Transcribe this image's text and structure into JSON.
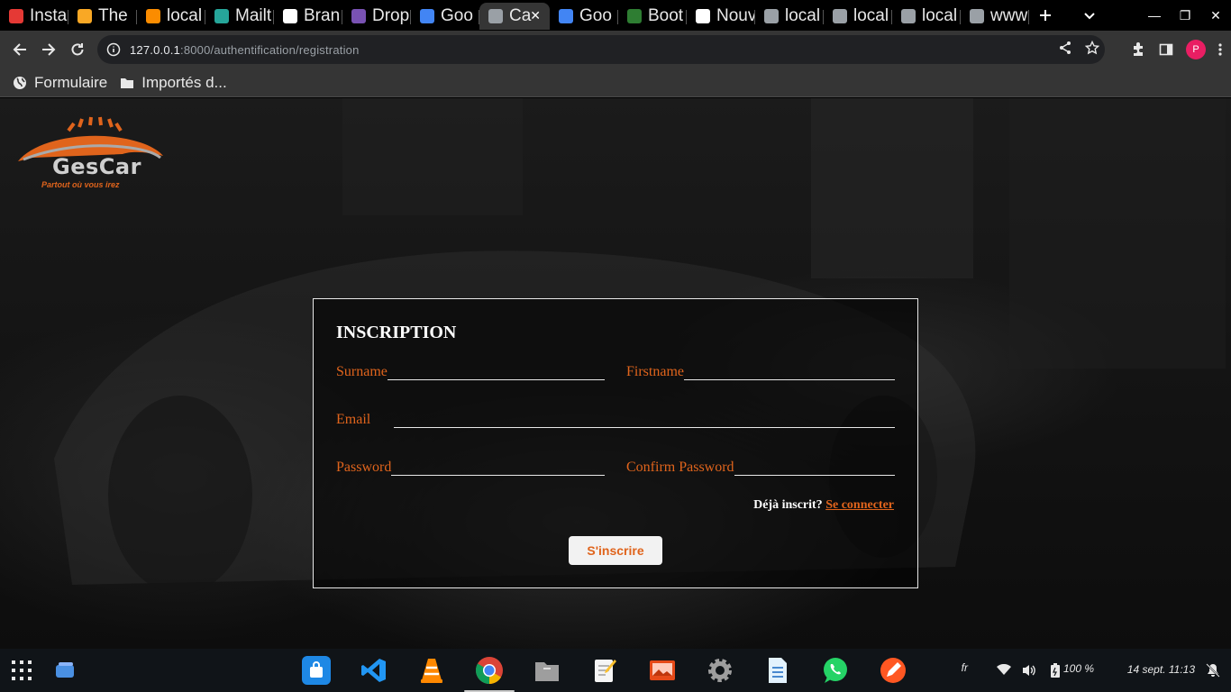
{
  "tabs": [
    {
      "label": "Insta",
      "icon": "stackedit-icon",
      "color": "#e53935"
    },
    {
      "label": "The",
      "icon": "bookmark-tab-icon",
      "color": "#f9a825"
    },
    {
      "label": "local",
      "icon": "xampp-icon",
      "color": "#fb8c00"
    },
    {
      "label": "Mailt",
      "icon": "mailtrap-icon",
      "color": "#26a69a"
    },
    {
      "label": "Bran",
      "icon": "github-icon",
      "color": "#ffffff"
    },
    {
      "label": "Drop",
      "icon": "bootstrap-icon",
      "color": "#7952b3"
    },
    {
      "label": "Goo",
      "icon": "google-icon",
      "color": "#4285f4"
    },
    {
      "label": "Ca",
      "icon": "globe-icon",
      "color": "#9aa0a6",
      "active": true
    },
    {
      "label": "Goo",
      "icon": "google-translate-icon",
      "color": "#4285f4"
    },
    {
      "label": "Boot",
      "icon": "w-icon",
      "color": "#2e7d32"
    },
    {
      "label": "Nouv",
      "icon": "chrome-icon",
      "color": "#ffffff"
    },
    {
      "label": "local",
      "icon": "globe-icon",
      "color": "#9aa0a6"
    },
    {
      "label": "local",
      "icon": "globe-icon",
      "color": "#9aa0a6"
    },
    {
      "label": "local",
      "icon": "globe-icon",
      "color": "#9aa0a6"
    },
    {
      "label": "www",
      "icon": "layers-icon",
      "color": "#9aa0a6"
    }
  ],
  "address": {
    "host": "127.0.0.1",
    "path": ":8000/authentification/registration"
  },
  "profile_initial": "P",
  "bookmarks": [
    {
      "label": "Formulaire",
      "icon": "globe-icon"
    },
    {
      "label": "Importés d...",
      "icon": "folder-icon"
    }
  ],
  "logo": {
    "name": "GesCar",
    "tagline": "Partout où vous irez"
  },
  "form": {
    "title": "INSCRIPTION",
    "surname_label": "Surname",
    "firstname_label": "Firstname",
    "email_label": "Email",
    "password_label": "Password",
    "confirm_label": "Confirm Password",
    "already_text": "Déjà inscrit?",
    "login_link": "Se connecter",
    "submit_label": "S'inscrire"
  },
  "taskbar": {
    "apps": [
      "software-store-icon",
      "vscode-icon",
      "vlc-icon",
      "chrome-icon",
      "files-icon",
      "text-editor-icon",
      "image-viewer-icon",
      "settings-icon",
      "document-icon",
      "whatsapp-icon",
      "drawing-icon"
    ],
    "lang": "fr",
    "battery": "100 %",
    "datetime": "14 sept. 11:13"
  },
  "colors": {
    "accent": "#e0641c",
    "tab_active": "#353535",
    "toolbar": "#353535"
  }
}
